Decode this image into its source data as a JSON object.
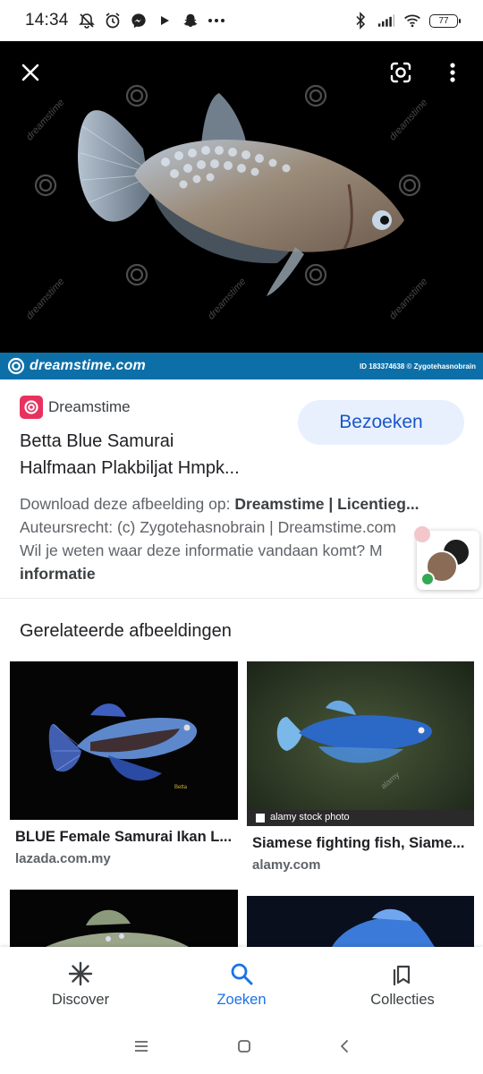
{
  "status_bar": {
    "time": "14:34",
    "battery": "77",
    "icons_left": [
      "muted-notification-icon",
      "alarm-icon",
      "messenger-icon",
      "play-icon",
      "snapchat-icon",
      "more-dots-icon"
    ],
    "icons_right": [
      "bluetooth-icon",
      "signal-icon",
      "wifi-icon",
      "battery-icon"
    ]
  },
  "viewer": {
    "close_icon": "close-icon",
    "lens_icon": "google-lens-icon",
    "menu_icon": "more-vert-icon",
    "watermark_text": "dreamstime",
    "source_bar": {
      "logo": "dreamstime.com",
      "credit": "ID 183374638 © Zygotehasnobrain"
    }
  },
  "result": {
    "site_name": "Dreamstime",
    "visit_label": "Bezoeken",
    "title_line1": "Betta Blue Samurai",
    "title_line2": "Halfmaan Plakbiljat Hmpk...",
    "meta_line1_prefix": "Download deze afbeelding op: ",
    "meta_line1_bold": "Dreamstime | Licentieg...",
    "meta_line2": "Auteursrecht: (c) Zygotehasnobrain | Dreamstime.com",
    "meta_line3": "Wil je weten waar deze informatie vandaan komt? M",
    "meta_line4_bold": "informatie"
  },
  "related": {
    "heading": "Gerelateerde afbeeldingen",
    "items": [
      {
        "title": "BLUE Female Samurai Ikan L...",
        "source": "lazada.com.my"
      },
      {
        "title": "Siamese fighting fish, Siame...",
        "source": "alamy.com",
        "badge": "alamy stock photo",
        "watermark": "alamy"
      }
    ]
  },
  "bottom_nav": {
    "items": [
      {
        "label": "Discover",
        "icon": "discover-asterisk-icon"
      },
      {
        "label": "Zoeken",
        "icon": "search-icon",
        "active": true
      },
      {
        "label": "Collecties",
        "icon": "collections-icon"
      }
    ]
  },
  "colors": {
    "accent": "#1a73e8",
    "visit_bg": "#e8f0fe",
    "source_bar": "#0d6fa8",
    "favicon": "#e8315e"
  }
}
